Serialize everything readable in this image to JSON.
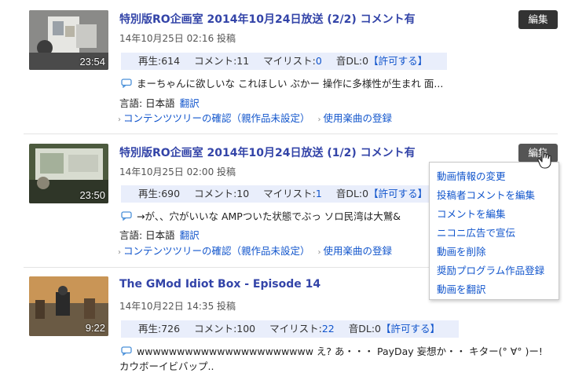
{
  "videos": [
    {
      "title": "特別版RO企画室 2014年10月24日放送 (2/2) コメント有",
      "posted": "14年10月25日 02:16 投稿",
      "duration": "23:54",
      "stats": {
        "views": "再生:614",
        "comments": "コメント:11",
        "mylist_label": "マイリスト:",
        "mylist_value": "0",
        "dl": "音DL:0",
        "allow": "【許可する】"
      },
      "comment": "まーちゃんに欲しいな これほしい ぶかー 操作に多様性が生まれ 面...",
      "lang_label": "言語: 日本語",
      "translate": "翻訳",
      "content_tree": "コンテンツツリーの確認（親作品未設定）",
      "music": "使用楽曲の登録",
      "edit": "編集"
    },
    {
      "title": "特別版RO企画室 2014年10月24日放送 (1/2) コメント有",
      "posted": "14年10月25日 02:00 投稿",
      "duration": "23:50",
      "stats": {
        "views": "再生:690",
        "comments": "コメント:10",
        "mylist_label": "マイリスト:",
        "mylist_value": "1",
        "dl": "音DL:0",
        "allow": "【許可する】"
      },
      "comment": "→が、、穴がいいな AMPついた状態でぶっ ソロ民湾は大鷲&",
      "lang_label": "言語: 日本語",
      "translate": "翻訳",
      "content_tree": "コンテンツツリーの確認（親作品未設定）",
      "music": "使用楽曲の登録",
      "edit": "編集"
    },
    {
      "title": "The GMod Idiot Box - Episode 14",
      "posted": "14年10月22日 14:35 投稿",
      "duration": "9:22",
      "stats": {
        "views": "再生:726",
        "comments": "コメント:100",
        "mylist_label": "マイリスト:",
        "mylist_value": "22",
        "dl": "音DL:0",
        "allow": "【許可する】"
      },
      "comment": "wwwwwwwwwwwwwwwwwwwwww え? あ・・・ PayDay 妄想か・・ キター(° ∀° )ー!",
      "comment2": "カウボーイビバップ.."
    }
  ],
  "menu": {
    "items": [
      "動画情報の変更",
      "投稿者コメントを編集",
      "コメントを編集",
      "ニコニ広告で宣伝",
      "動画を削除",
      "奨励プログラム作品登録",
      "動画を翻訳"
    ]
  }
}
